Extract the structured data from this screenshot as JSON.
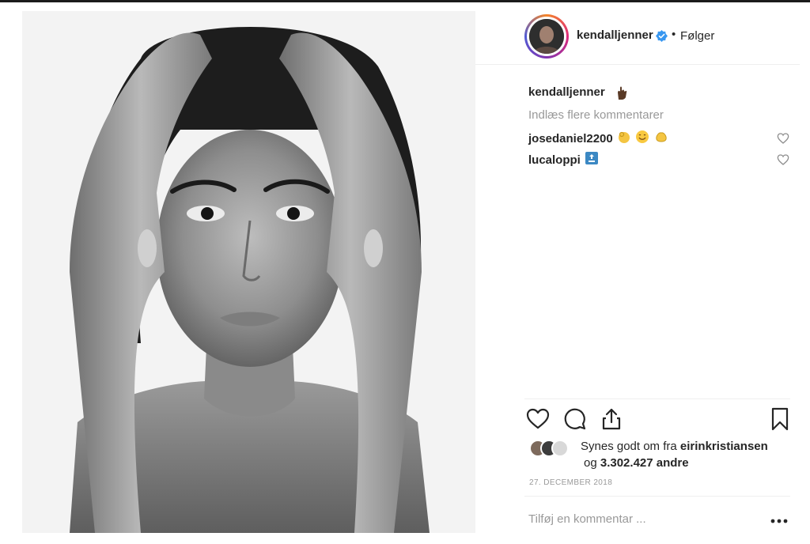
{
  "post": {
    "username": "kendalljenner",
    "separator": "•",
    "follow_label": "Følger",
    "verified": true
  },
  "caption": {
    "username": "kendalljenner",
    "emoji": "hand-emoji"
  },
  "comments": {
    "load_more_label": "Indlæs flere kommentarer",
    "items": [
      {
        "username": "josedaniel2200",
        "emojis": [
          "ok-hand-emoji",
          "smiling-face-emoji",
          "clapping-hands-emoji"
        ]
      },
      {
        "username": "lucaloppi",
        "emojis": [
          "top-arrow-emoji"
        ]
      }
    ]
  },
  "likes": {
    "line_prefix": "Synes godt om fra",
    "top_liker": "eirinkristiansen",
    "line2_prefix": "og",
    "count": "3.302.427",
    "line2_suffix": "andre"
  },
  "date": "27. DECEMBER 2018",
  "comment_box": {
    "placeholder": "Tilføj en kommentar ..."
  },
  "colors": {
    "verified_blue": "#3897f0",
    "text": "#262626",
    "muted": "#999999",
    "divider": "#efefef"
  }
}
